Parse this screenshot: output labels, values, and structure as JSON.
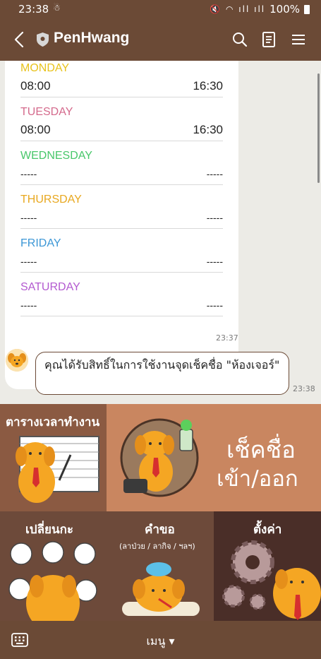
{
  "status_bar": {
    "time": "23:38",
    "battery": "100%"
  },
  "header": {
    "title": "PenHwang"
  },
  "schedule": [
    {
      "day": "MONDAY",
      "color": "#e8c21c",
      "start": "08:00",
      "end": "16:30"
    },
    {
      "day": "TUESDAY",
      "color": "#d46a8c",
      "start": "08:00",
      "end": "16:30"
    },
    {
      "day": "WEDNESDAY",
      "color": "#48c76a",
      "start": "-----",
      "end": "-----"
    },
    {
      "day": "THURSDAY",
      "color": "#e8a820",
      "start": "-----",
      "end": "-----"
    },
    {
      "day": "FRIDAY",
      "color": "#3c97d6",
      "start": "-----",
      "end": "-----"
    },
    {
      "day": "SATURDAY",
      "color": "#b35ad0",
      "start": "-----",
      "end": "-----"
    }
  ],
  "chat": {
    "card_timestamp": "23:37",
    "message_text": "คุณได้รับสิทธิ์ในการใช้งานจุดเช็คชื่อ \"ห้องเจอร์\"",
    "message_timestamp": "23:38"
  },
  "rich_menu": {
    "timetable": "ตารางเวลาทำงาน",
    "checkin": "เช็คชื่อ",
    "checkin_sub": "เข้า/ออก",
    "change_shift": "เปลี่ยนกะ",
    "request": "คำขอ",
    "request_sub": "(ลาป่วย / ลากิจ / ฯลฯ)",
    "settings": "ตั้งค่า"
  },
  "bottom_bar": {
    "menu_label": "เมนู ▾"
  },
  "colors": {
    "header_brown": "#6b4a36",
    "menu_brown": "#8b5a42",
    "dog_orange": "#f5a623"
  }
}
